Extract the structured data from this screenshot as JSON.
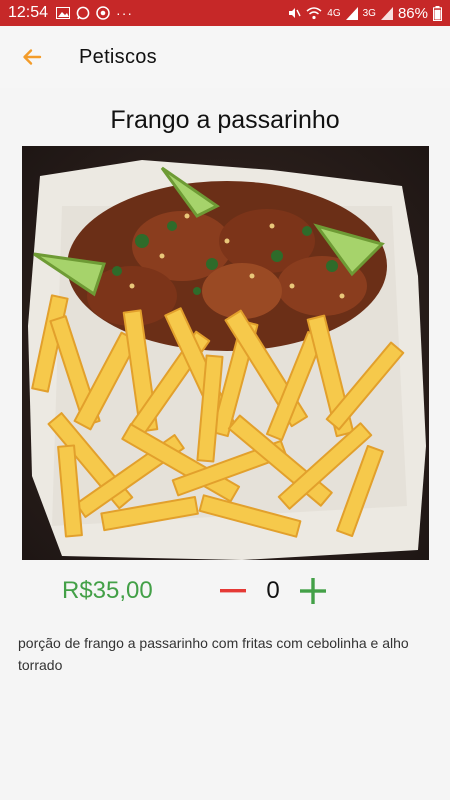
{
  "status_bar": {
    "time": "12:54",
    "network_1": "4G",
    "network_2": "3G",
    "battery": "86%",
    "left_icons": [
      "image-icon",
      "whatsapp-icon",
      "chrome-icon",
      "more-dots-icon"
    ],
    "right_icons": [
      "mute-icon",
      "wifi-icon",
      "signal-icon",
      "battery-icon"
    ]
  },
  "app_bar": {
    "back_icon": "arrow-left-icon",
    "title": "Petiscos"
  },
  "product": {
    "name": "Frango a passarinho",
    "price": "R$35,00",
    "quantity": "0",
    "description": "porção de frango a passarinho com fritas com cebolinha e alho torrado"
  },
  "colors": {
    "status_bar": "#c62828",
    "accent_orange": "#f39c2a",
    "price_green": "#43a047",
    "minus_red": "#e53935",
    "plus_green": "#43a047"
  }
}
